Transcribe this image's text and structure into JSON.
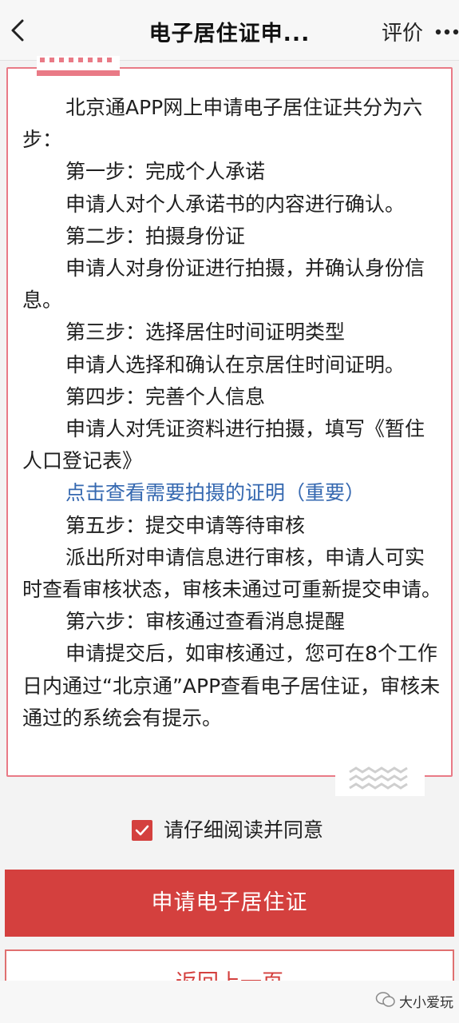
{
  "header": {
    "title": "电子居住证申...",
    "rate_label": "评价"
  },
  "content": {
    "paragraphs": [
      "北京通APP网上申请电子居住证共分为六步：",
      "第一步：完成个人承诺",
      "申请人对个人承诺书的内容进行确认。",
      "第二步：拍摄身份证",
      "申请人对身份证进行拍摄，并确认身份信息。",
      "第三步：选择居住时间证明类型",
      "申请人选择和确认在京居住时间证明。",
      "第四步：完善个人信息",
      "申请人对凭证资料进行拍摄，填写《暂住人口登记表》",
      "点击查看需要拍摄的证明（重要）",
      "第五步：提交申请等待审核",
      "派出所对申请信息进行审核，申请人可实时查看审核状态，审核未通过可重新提交申请。",
      "第六步：审核通过查看消息提醒",
      "申请提交后，如审核通过，您可在8个工作日内通过“北京通”APP查看电子居住证，审核未通过的系统会有提示。"
    ]
  },
  "agreement": {
    "checked": true,
    "label": "请仔细阅读并同意"
  },
  "buttons": {
    "apply": "申请电子居住证",
    "back": "返回上一页"
  },
  "watermark": {
    "text": "大小爱玩"
  },
  "colors": {
    "accent": "#d4403e",
    "border": "#e97a86",
    "link": "#3568b0"
  }
}
